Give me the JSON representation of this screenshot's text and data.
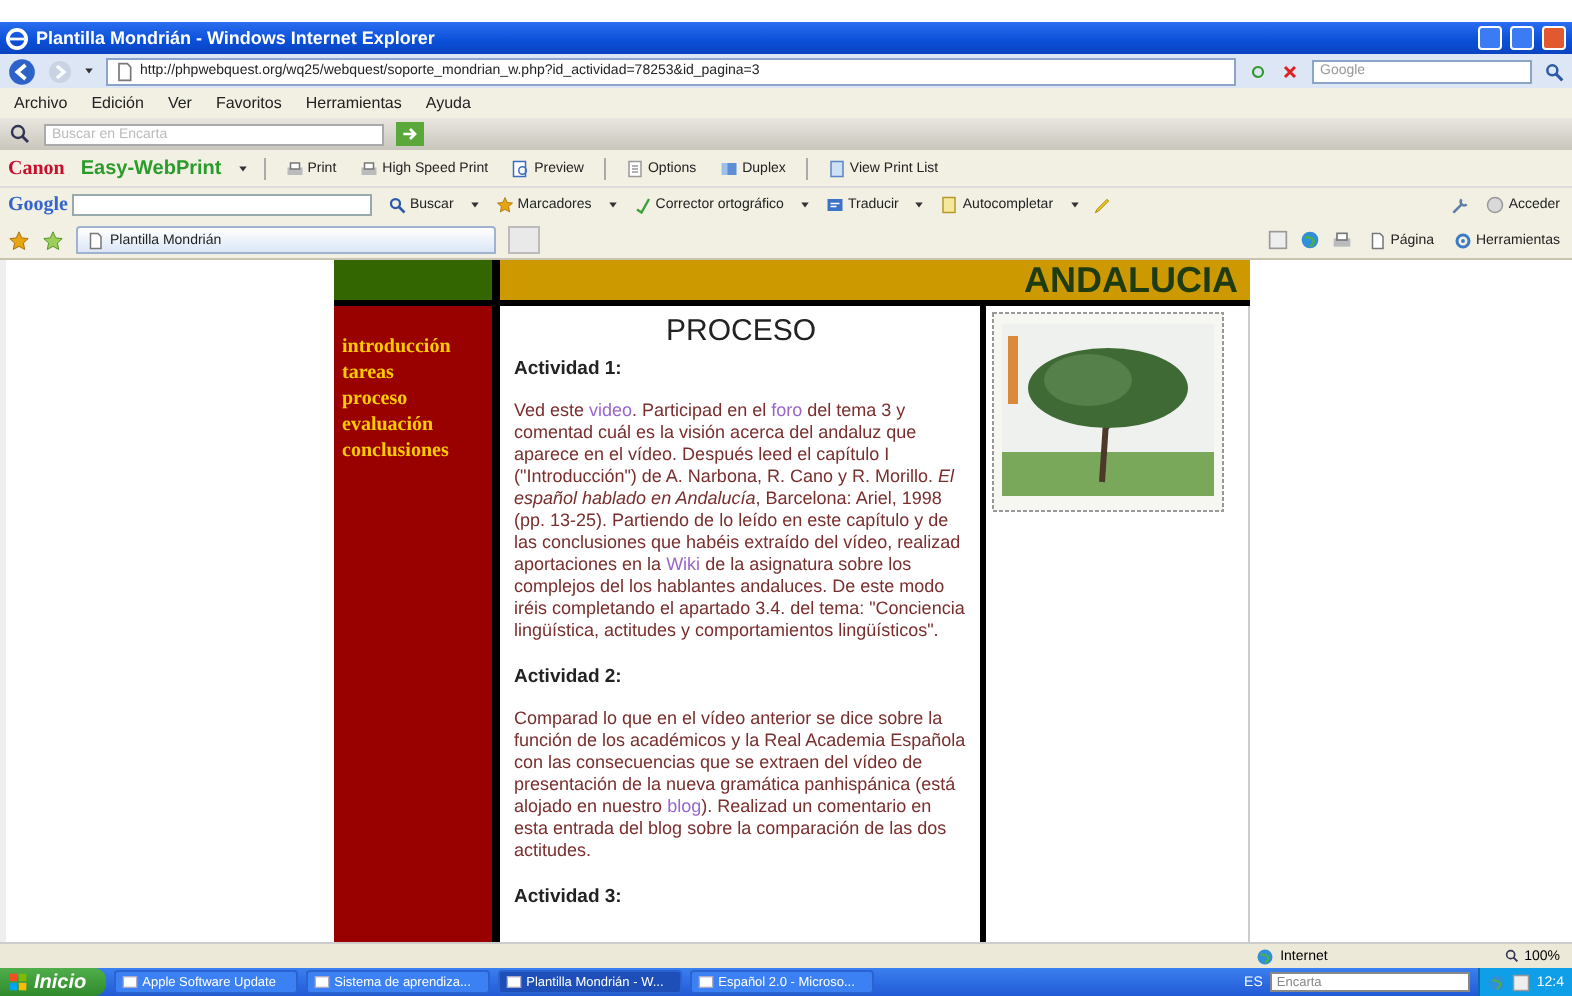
{
  "window": {
    "title": "Plantilla Mondrián - Windows Internet Explorer"
  },
  "address_bar": {
    "url": "http://phpwebquest.org/wq25/webquest/soporte_mondrian_w.php?id_actividad=78253&id_pagina=3",
    "search_placeholder": "Google"
  },
  "menu_bar": [
    "Archivo",
    "Edición",
    "Ver",
    "Favoritos",
    "Herramientas",
    "Ayuda"
  ],
  "encarta_bar": {
    "placeholder": "Buscar en Encarta"
  },
  "print_toolbar": {
    "brand": "Canon",
    "product": "Easy-WebPrint",
    "buttons": [
      {
        "label": "Print",
        "kind": "print"
      },
      {
        "label": "High Speed Print",
        "kind": "print"
      },
      {
        "label": "Preview",
        "kind": "preview"
      },
      {
        "label": "Options",
        "kind": "options"
      },
      {
        "label": "Duplex",
        "kind": "duplex"
      },
      {
        "label": "View Print List",
        "kind": "list"
      }
    ]
  },
  "google_toolbar": {
    "logo": "Google",
    "items": [
      {
        "label": "Buscar",
        "kind": "search"
      },
      {
        "label": "Marcadores",
        "kind": "star"
      },
      {
        "label": "Corrector ortográfico",
        "kind": "spell"
      },
      {
        "label": "Traducir",
        "kind": "translate"
      },
      {
        "label": "Autocompletar",
        "kind": "autofill"
      }
    ],
    "sign_in": "Acceder"
  },
  "favorites_bar": {
    "tabs": [
      {
        "label": "Plantilla Mondrián",
        "selected": true
      }
    ],
    "commands": [
      {
        "label": "Página",
        "kind": "page"
      },
      {
        "label": "Herramientas",
        "kind": "tools"
      }
    ]
  },
  "page": {
    "banner": "ANDALUCIA",
    "nav": [
      "introducción",
      "tareas",
      "proceso",
      "evaluación",
      "conclusiones"
    ],
    "heading": "PROCESO",
    "sections": [
      {
        "title": "Actividad 1:",
        "paragraph": [
          {
            "kind": "text",
            "text": "Ved este "
          },
          {
            "kind": "link",
            "text": "video"
          },
          {
            "kind": "text",
            "text": ". Participad en el "
          },
          {
            "kind": "link",
            "text": "foro"
          },
          {
            "kind": "text",
            "text": " del tema 3 y comentad cuál es la visión acerca del andaluz que aparece en el vídeo. Después leed el capítulo I (\"Introducción\") de A. Narbona, R. Cano y R. Morillo. "
          },
          {
            "kind": "italic",
            "text": "El español hablado en Andalucía"
          },
          {
            "kind": "text",
            "text": ", Barcelona: Ariel, 1998 (pp. 13-25). Partiendo de lo leído en este capítulo y de las conclusiones que habéis extraído del vídeo, realizad aportaciones en la "
          },
          {
            "kind": "link",
            "text": "Wiki"
          },
          {
            "kind": "text",
            "text": " de la asignatura sobre los complejos del los hablantes andaluces. De este modo iréis completando el apartado 3.4. del tema: \"Conciencia lingüística, actitudes y comportamientos lingüísticos\"."
          }
        ]
      },
      {
        "title": "Actividad 2:",
        "paragraph": [
          {
            "kind": "text",
            "text": "Comparad lo que en el vídeo anterior se dice sobre la función de los académicos y la Real Academia Española con las consecuencias que se extraen del vídeo de presentación de la nueva gramática panhispánica (está alojado en nuestro "
          },
          {
            "kind": "link",
            "text": "blog"
          },
          {
            "kind": "text",
            "text": "). Realizad un comentario en esta entrada del blog sobre la comparación de las dos actitudes."
          }
        ]
      },
      {
        "title": "Actividad 3:"
      }
    ]
  },
  "status_bar": {
    "zone": "Internet",
    "zoom": "100%"
  },
  "taskbar": {
    "start": "Inicio",
    "tasks": [
      {
        "label": "Apple Software Update",
        "selected": false
      },
      {
        "label": "Sistema de aprendiza...",
        "selected": false
      },
      {
        "label": "Plantilla Mondrián - W...",
        "selected": true
      },
      {
        "label": "Español 2.0 - Microso...",
        "selected": false
      }
    ],
    "language": "ES",
    "search_placeholder": "Encarta",
    "clock": "12:4"
  }
}
